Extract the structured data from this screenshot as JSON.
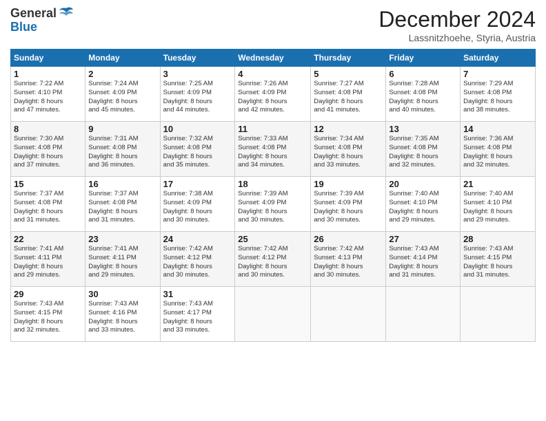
{
  "header": {
    "logo_line1": "General",
    "logo_line2": "Blue",
    "month_title": "December 2024",
    "location": "Lassnitzhoehe, Styria, Austria"
  },
  "days_of_week": [
    "Sunday",
    "Monday",
    "Tuesday",
    "Wednesday",
    "Thursday",
    "Friday",
    "Saturday"
  ],
  "weeks": [
    [
      {
        "day": "1",
        "info": "Sunrise: 7:22 AM\nSunset: 4:10 PM\nDaylight: 8 hours\nand 47 minutes."
      },
      {
        "day": "2",
        "info": "Sunrise: 7:24 AM\nSunset: 4:09 PM\nDaylight: 8 hours\nand 45 minutes."
      },
      {
        "day": "3",
        "info": "Sunrise: 7:25 AM\nSunset: 4:09 PM\nDaylight: 8 hours\nand 44 minutes."
      },
      {
        "day": "4",
        "info": "Sunrise: 7:26 AM\nSunset: 4:09 PM\nDaylight: 8 hours\nand 42 minutes."
      },
      {
        "day": "5",
        "info": "Sunrise: 7:27 AM\nSunset: 4:08 PM\nDaylight: 8 hours\nand 41 minutes."
      },
      {
        "day": "6",
        "info": "Sunrise: 7:28 AM\nSunset: 4:08 PM\nDaylight: 8 hours\nand 40 minutes."
      },
      {
        "day": "7",
        "info": "Sunrise: 7:29 AM\nSunset: 4:08 PM\nDaylight: 8 hours\nand 38 minutes."
      }
    ],
    [
      {
        "day": "8",
        "info": "Sunrise: 7:30 AM\nSunset: 4:08 PM\nDaylight: 8 hours\nand 37 minutes."
      },
      {
        "day": "9",
        "info": "Sunrise: 7:31 AM\nSunset: 4:08 PM\nDaylight: 8 hours\nand 36 minutes."
      },
      {
        "day": "10",
        "info": "Sunrise: 7:32 AM\nSunset: 4:08 PM\nDaylight: 8 hours\nand 35 minutes."
      },
      {
        "day": "11",
        "info": "Sunrise: 7:33 AM\nSunset: 4:08 PM\nDaylight: 8 hours\nand 34 minutes."
      },
      {
        "day": "12",
        "info": "Sunrise: 7:34 AM\nSunset: 4:08 PM\nDaylight: 8 hours\nand 33 minutes."
      },
      {
        "day": "13",
        "info": "Sunrise: 7:35 AM\nSunset: 4:08 PM\nDaylight: 8 hours\nand 32 minutes."
      },
      {
        "day": "14",
        "info": "Sunrise: 7:36 AM\nSunset: 4:08 PM\nDaylight: 8 hours\nand 32 minutes."
      }
    ],
    [
      {
        "day": "15",
        "info": "Sunrise: 7:37 AM\nSunset: 4:08 PM\nDaylight: 8 hours\nand 31 minutes."
      },
      {
        "day": "16",
        "info": "Sunrise: 7:37 AM\nSunset: 4:08 PM\nDaylight: 8 hours\nand 31 minutes."
      },
      {
        "day": "17",
        "info": "Sunrise: 7:38 AM\nSunset: 4:09 PM\nDaylight: 8 hours\nand 30 minutes."
      },
      {
        "day": "18",
        "info": "Sunrise: 7:39 AM\nSunset: 4:09 PM\nDaylight: 8 hours\nand 30 minutes."
      },
      {
        "day": "19",
        "info": "Sunrise: 7:39 AM\nSunset: 4:09 PM\nDaylight: 8 hours\nand 30 minutes."
      },
      {
        "day": "20",
        "info": "Sunrise: 7:40 AM\nSunset: 4:10 PM\nDaylight: 8 hours\nand 29 minutes."
      },
      {
        "day": "21",
        "info": "Sunrise: 7:40 AM\nSunset: 4:10 PM\nDaylight: 8 hours\nand 29 minutes."
      }
    ],
    [
      {
        "day": "22",
        "info": "Sunrise: 7:41 AM\nSunset: 4:11 PM\nDaylight: 8 hours\nand 29 minutes."
      },
      {
        "day": "23",
        "info": "Sunrise: 7:41 AM\nSunset: 4:11 PM\nDaylight: 8 hours\nand 29 minutes."
      },
      {
        "day": "24",
        "info": "Sunrise: 7:42 AM\nSunset: 4:12 PM\nDaylight: 8 hours\nand 30 minutes."
      },
      {
        "day": "25",
        "info": "Sunrise: 7:42 AM\nSunset: 4:12 PM\nDaylight: 8 hours\nand 30 minutes."
      },
      {
        "day": "26",
        "info": "Sunrise: 7:42 AM\nSunset: 4:13 PM\nDaylight: 8 hours\nand 30 minutes."
      },
      {
        "day": "27",
        "info": "Sunrise: 7:43 AM\nSunset: 4:14 PM\nDaylight: 8 hours\nand 31 minutes."
      },
      {
        "day": "28",
        "info": "Sunrise: 7:43 AM\nSunset: 4:15 PM\nDaylight: 8 hours\nand 31 minutes."
      }
    ],
    [
      {
        "day": "29",
        "info": "Sunrise: 7:43 AM\nSunset: 4:15 PM\nDaylight: 8 hours\nand 32 minutes."
      },
      {
        "day": "30",
        "info": "Sunrise: 7:43 AM\nSunset: 4:16 PM\nDaylight: 8 hours\nand 33 minutes."
      },
      {
        "day": "31",
        "info": "Sunrise: 7:43 AM\nSunset: 4:17 PM\nDaylight: 8 hours\nand 33 minutes."
      },
      null,
      null,
      null,
      null
    ]
  ]
}
